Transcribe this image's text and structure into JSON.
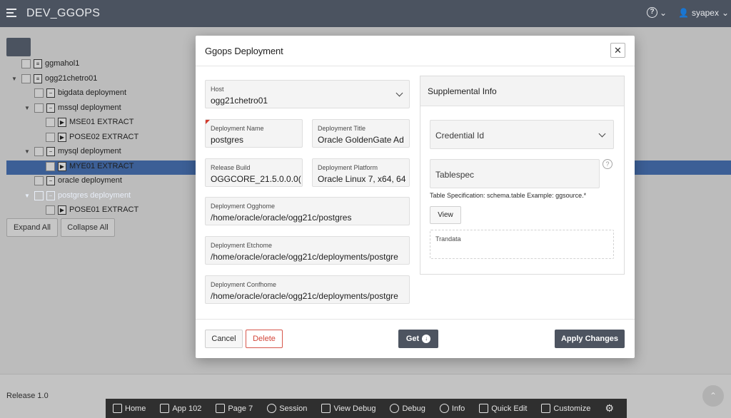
{
  "header": {
    "app_title": "DEV_GGOPS",
    "user": "syapex"
  },
  "tree": {
    "items": [
      {
        "label": "ggmahol1"
      },
      {
        "label": "ogg21chetro01"
      },
      {
        "label": "bigdata deployment"
      },
      {
        "label": "mssql deployment"
      },
      {
        "label": "MSE01 EXTRACT"
      },
      {
        "label": "POSE02 EXTRACT"
      },
      {
        "label": "mysql deployment"
      },
      {
        "label": "MYE01 EXTRACT"
      },
      {
        "label": "oracle deployment"
      },
      {
        "label": "postgres deployment"
      },
      {
        "label": "POSE01 EXTRACT"
      }
    ],
    "expand_all": "Expand All",
    "collapse_all": "Collapse All"
  },
  "footer": {
    "release": "Release 1.0"
  },
  "devbar": {
    "items": [
      {
        "label": "Home",
        "icon": "home-icon"
      },
      {
        "label": "App 102",
        "icon": "edit-icon"
      },
      {
        "label": "Page 7",
        "icon": "page-icon"
      },
      {
        "label": "Session",
        "icon": "session-icon"
      },
      {
        "label": "View Debug",
        "icon": "view-debug-icon"
      },
      {
        "label": "Debug",
        "icon": "bug-icon"
      },
      {
        "label": "Info",
        "icon": "info-icon"
      },
      {
        "label": "Quick Edit",
        "icon": "quick-edit-icon"
      },
      {
        "label": "Customize",
        "icon": "brush-icon"
      }
    ]
  },
  "dialog": {
    "title": "Ggops Deployment",
    "host_label": "Host",
    "host_value": "ogg21chetro01",
    "deployment_name_label": "Deployment Name",
    "deployment_name_value": "postgres",
    "deployment_title_label": "Deployment Title",
    "deployment_title_value": "Oracle GoldenGate Ad",
    "release_build_label": "Release Build",
    "release_build_value": "OGGCORE_21.5.0.0.0(",
    "deployment_platform_label": "Deployment Platform",
    "deployment_platform_value": "Oracle Linux 7, x64, 64",
    "ogghome_label": "Deployment Ogghome",
    "ogghome_value": "/home/oracle/oracle/ogg21c/postgres",
    "etchome_label": "Deployment Etchome",
    "etchome_value": "/home/oracle/oracle/ogg21c/deployments/postgre",
    "confhome_label": "Deployment Confhome",
    "confhome_value": "/home/oracle/oracle/ogg21c/deployments/postgre",
    "supplemental": {
      "title": "Supplemental Info",
      "credential_placeholder": "Credential Id",
      "tablespec_placeholder": "Tablespec",
      "tablespec_help": "Table Specification: schema.table Example: ggsource.*",
      "view_button": "View",
      "trandata_label": "Trandata"
    },
    "buttons": {
      "cancel": "Cancel",
      "delete": "Delete",
      "get": "Get",
      "apply": "Apply Changes"
    }
  }
}
